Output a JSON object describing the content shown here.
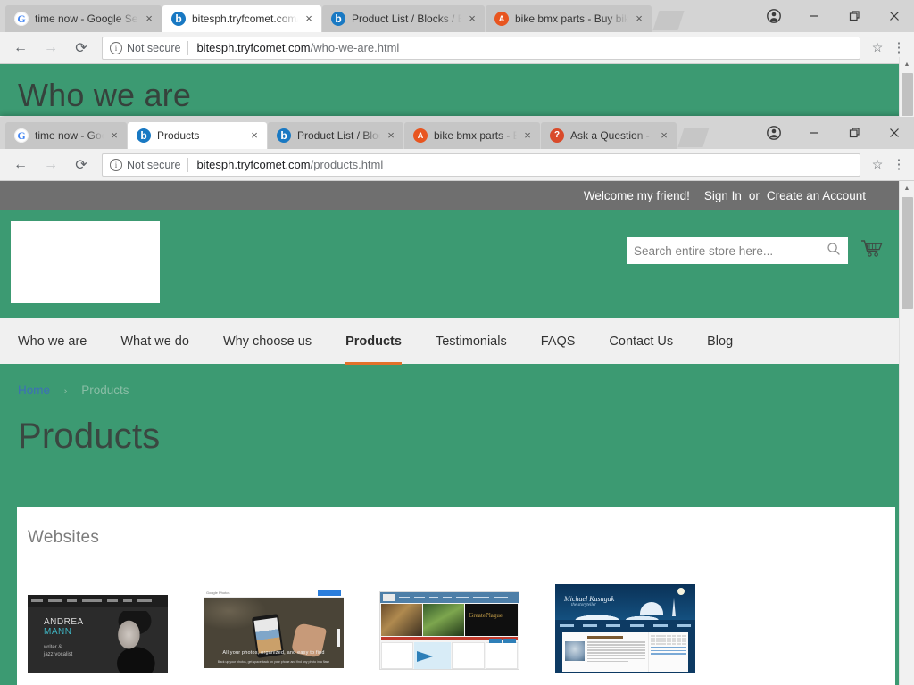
{
  "window_top": {
    "tabs": [
      {
        "title": "time now - Google Search",
        "favicon": "google-icon",
        "active": false
      },
      {
        "title": "bitesph.tryfcomet.com/who-we-are.html",
        "favicon": "magento-icon",
        "active": true
      },
      {
        "title": "Product List / Blocks / Elements",
        "favicon": "magento-icon",
        "active": false
      },
      {
        "title": "bike bmx parts - Buy bike bmx parts",
        "favicon": "alibaba-icon",
        "active": false
      }
    ],
    "close_label": "×",
    "toolbar": {
      "back": "←",
      "forward": "→",
      "reload": "⟳",
      "security_label": "Not secure",
      "url_main": "bitesph.tryfcomet.com",
      "url_path": "/who-we-are.html",
      "star": "☆",
      "menu": "⋮"
    },
    "controls": {
      "minimize": "–",
      "maximize": "❐",
      "close": "✕",
      "profile": "profile-icon"
    },
    "page_title": "Who we are"
  },
  "window_main": {
    "tabs": [
      {
        "title": "time now - Google Search",
        "favicon": "google-icon",
        "active": false
      },
      {
        "title": "Products",
        "favicon": "magento-icon",
        "active": true
      },
      {
        "title": "Product List / Blocks / Elements",
        "favicon": "magento-icon",
        "active": false
      },
      {
        "title": "bike bmx parts - Buy bike bmx parts",
        "favicon": "alibaba-icon",
        "active": false
      },
      {
        "title": "Ask a Question - Help Center",
        "favicon": "question-icon",
        "active": false
      }
    ],
    "close_label": "×",
    "toolbar": {
      "back": "←",
      "forward": "→",
      "reload": "⟳",
      "security_label": "Not secure",
      "url_main": "bitesph.tryfcomet.com",
      "url_path": "/products.html",
      "star": "☆",
      "menu": "⋮"
    },
    "controls": {
      "minimize": "–",
      "maximize": "❐",
      "close": "✕",
      "profile": "profile-icon"
    }
  },
  "site": {
    "welcome": {
      "greeting": "Welcome my friend!",
      "sign_in": "Sign In",
      "or": "or",
      "create_account": "Create an Account"
    },
    "search": {
      "placeholder": "Search entire store here...",
      "value": "",
      "icon": "search-icon"
    },
    "cart_icon": "shopping-cart-icon",
    "nav": [
      {
        "label": "Who we are",
        "active": false
      },
      {
        "label": "What we do",
        "active": false
      },
      {
        "label": "Why choose us",
        "active": false
      },
      {
        "label": "Products",
        "active": true
      },
      {
        "label": "Testimonials",
        "active": false
      },
      {
        "label": "FAQS",
        "active": false
      },
      {
        "label": "Contact Us",
        "active": false
      },
      {
        "label": "Blog",
        "active": false
      }
    ],
    "breadcrumb": {
      "home": "Home",
      "separator": "›",
      "current": "Products"
    },
    "page_title": "Products",
    "section": {
      "title": "Websites",
      "items": [
        {
          "name": "andrea-mann",
          "heading": "ANDREA",
          "heading2": "MANN",
          "subtitle": "writer &\njazz vocalist",
          "nav": [
            "HOME",
            "WRITING",
            "MUSIC",
            "PHOTOGRAPHY",
            "ABOUT",
            "BLOG",
            "CONTACT"
          ]
        },
        {
          "name": "google-photos",
          "brand": "Google Photos",
          "button": "Go to Google Photos",
          "caption": "All your photos, organized, and easy to find",
          "caption2": "Back up your photos, get space back on your phone and find any photo in a flash"
        },
        {
          "name": "news-portal",
          "headline": "GreatePlague"
        },
        {
          "name": "michael-kusugak",
          "heading": "Michael Kusugak",
          "subtitle": "the storyteller",
          "menu": [
            "The Storyteller",
            "The Books",
            "Bookings & Appearances",
            "Photos & Interviews",
            "Educational Resources",
            "Contact Michael"
          ],
          "article_title": "Michael Kusugak",
          "article_sub": "Michael Kusugak awarded with The Vicky Metcalf Award for Children's Literature",
          "calendar": "March 2014",
          "side_title": "Upcoming Appearances"
        }
      ]
    },
    "colors": {
      "brand_green": "#3c9a72",
      "accent_orange": "#e2712b",
      "welcome_gray": "#6f6f6f",
      "nav_bg": "#f0f0f0",
      "link_blue": "#3c6fb6"
    }
  },
  "scrollbar": {
    "up_arrow": "▲",
    "down_arrow": "▼"
  }
}
